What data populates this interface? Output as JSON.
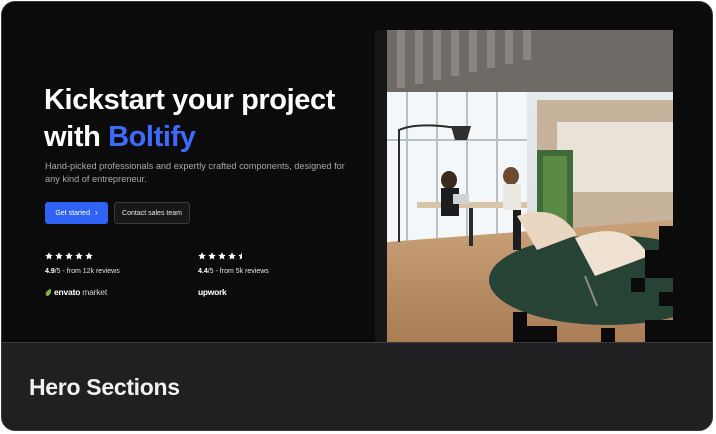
{
  "hero": {
    "headline_line1": "Kickstart your project",
    "headline_prefix": "with",
    "brand_name": "Boltify",
    "subtext": "Hand-picked professionals and expertly crafted components, designed for any kind of entrepreneur.",
    "primary_button": "Get started",
    "secondary_button": "Contact sales team"
  },
  "reviews": [
    {
      "rating": "4.9",
      "scale": "/5",
      "source_text": " - from 12k reviews",
      "stars": 5,
      "logo_word": "envato",
      "logo_suffix": "market",
      "icon": "envato-leaf-icon"
    },
    {
      "rating": "4.4",
      "scale": "/5",
      "source_text": " - from 5k reviews",
      "stars": 4.5,
      "logo_word": "upwork",
      "icon": "upwork-logo-icon"
    }
  ],
  "footer": {
    "title": "Hero Sections"
  },
  "colors": {
    "accent": "#2f62f5",
    "brand_text": "#3d6bff",
    "envato_green": "#82b541",
    "background": "#0b0b0c"
  }
}
